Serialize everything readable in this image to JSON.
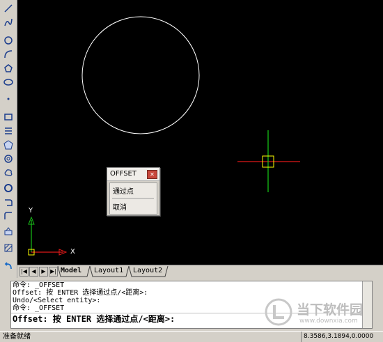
{
  "toolbar": {
    "tools": [
      "line-tool",
      "polyline-tool",
      "circle-tool",
      "arc-tool",
      "polygon-tool",
      "ellipse-tool",
      "point-tool",
      "rectangle-tool",
      "multiline-tool",
      "region-tool",
      "donut-tool",
      "revision-cloud-tool",
      "ring-tool",
      "spline-tool",
      "insert-block-tool",
      "make-block-tool",
      "hatch-tool",
      "undo-tool"
    ]
  },
  "canvas": {
    "axis_y": "Y",
    "axis_x": "X"
  },
  "popup": {
    "title": "OFFSET",
    "items": [
      "通过点",
      "取消"
    ]
  },
  "tabs": {
    "model": "Model",
    "layout1": "Layout1",
    "layout2": "Layout2"
  },
  "command": {
    "lines": [
      "命令: _OFFSET",
      "Offset: 按 ENTER 选择通过点/<距离>:",
      "Undo/<Select entity>:",
      "命令: _OFFSET"
    ],
    "prompt": "Offset: 按 ENTER 选择通过点/<距离>:"
  },
  "status": {
    "text": "准备就绪",
    "coords": "8.3586,3.1894,0.0000"
  },
  "watermark": {
    "name": "当下软件园",
    "url": "www.downxia.com"
  }
}
